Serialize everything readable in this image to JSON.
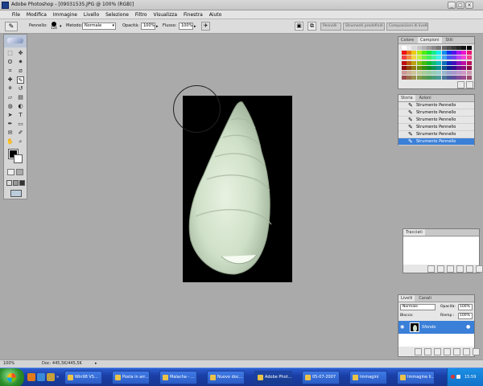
{
  "window": {
    "title": "Adobe Photoshop - [09031535.JPG @ 100% (RGB)]",
    "controls": [
      "_",
      "□",
      "×"
    ]
  },
  "menu": [
    "File",
    "Modifica",
    "Immagine",
    "Livello",
    "Selezione",
    "Filtro",
    "Visualizza",
    "Finestra",
    "Aiuto"
  ],
  "options": {
    "tool_label": "Pennello:",
    "brush_size": "124",
    "mode_label": "Metodo:",
    "mode_value": "Normale",
    "opacity_label": "Opacità:",
    "opacity_value": "100%",
    "flow_label": "Flusso:",
    "flow_value": "100%",
    "wells": [
      "Pennelli",
      "Strumenti predefiniti",
      "Composizioni di livelli"
    ]
  },
  "toolbox": {
    "tools": [
      "marquee-icon",
      "move-icon",
      "lasso-icon",
      "magic-wand-icon",
      "crop-icon",
      "slice-icon",
      "healing-icon",
      "brush-icon",
      "stamp-icon",
      "history-brush-icon",
      "eraser-icon",
      "gradient-icon",
      "blur-icon",
      "dodge-icon",
      "path-select-icon",
      "type-icon",
      "pen-icon",
      "shape-icon",
      "notes-icon",
      "eyedropper-icon",
      "hand-icon",
      "zoom-icon"
    ],
    "glyphs": [
      "⬚",
      "✥",
      "ʘ",
      "✷",
      "⌗",
      "⧄",
      "✚",
      "✎",
      "⚘",
      "↺",
      "▱",
      "▤",
      "◍",
      "◐",
      "➤",
      "T",
      "✒",
      "▭",
      "✉",
      "✐",
      "✋",
      "⌕"
    ],
    "fg_color": "#000000",
    "bg_color": "#ffffff"
  },
  "colors_panel": {
    "tabs": [
      "Colore",
      "Campioni",
      "Stili"
    ],
    "active_tab": 1
  },
  "history_panel": {
    "tabs": [
      "Storia",
      "Azioni"
    ],
    "items": [
      "Strumento Pennello",
      "Strumento Pennello",
      "Strumento Pennello",
      "Strumento Pennello",
      "Strumento Pennello",
      "Strumento Pennello"
    ],
    "selected_index": 5
  },
  "paths_panel": {
    "tabs": [
      "Tracciati"
    ]
  },
  "layers_panel": {
    "tabs": [
      "Livelli",
      "Canali"
    ],
    "blend_mode": "Normale",
    "opacity_label": "Opacità:",
    "opacity_value": "100%",
    "lock_label": "Blocca:",
    "fill_label": "Riemp.:",
    "fill_value": "100%",
    "layers": [
      {
        "name": "Sfondo",
        "selected": true
      }
    ]
  },
  "status": {
    "zoom": "100%",
    "doc_info": "Doc: 445,5K/445,5K"
  },
  "taskbar": {
    "tasks": [
      "Win98 VS...",
      "Posta in arr...",
      "Malacha - ...",
      "Nuovo doc...",
      "Adobe Phot...",
      "05-07-2007",
      "Immagini",
      "Immagine li..."
    ],
    "active_index": 4,
    "clock": "15:59"
  },
  "colors": {
    "accent": "#3a7fd8",
    "workspace": "#aaaaaa"
  }
}
